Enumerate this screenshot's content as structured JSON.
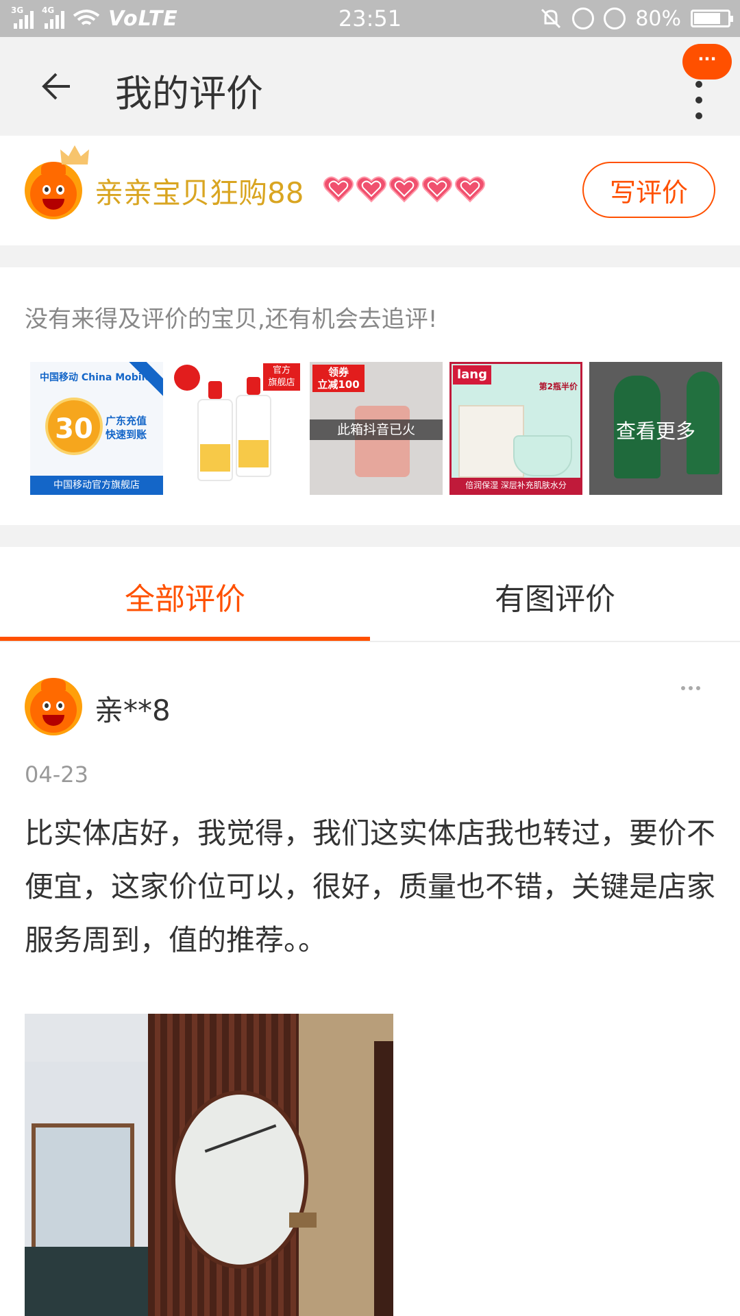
{
  "status_bar": {
    "network_left": "3G",
    "network_right": "4G",
    "volte": "VoLTE",
    "time": "23:51",
    "battery": "80%",
    "battery_level": 0.8
  },
  "header": {
    "title": "我的评价",
    "message_badge": "···"
  },
  "user": {
    "name": "亲亲宝贝狂购88",
    "hearts_count": 5,
    "write_button": "写评价"
  },
  "pending": {
    "tip": "没有来得及评价的宝贝,还有机会去追评!",
    "items": [
      {
        "brand": "中国移动 China Mobile",
        "amount": "30",
        "subtitle_1": "广东充值",
        "subtitle_2": "快速到账",
        "band": "中国移动官方旗舰店"
      },
      {
        "tag_1": "官方",
        "tag_2": "旗舰店"
      },
      {
        "coupon_1": "领券",
        "coupon_2": "立减100",
        "band": "此箱抖音已火"
      },
      {
        "logo": "lang",
        "corner": "第2瓶半价",
        "band": "倍润保湿  深层补充肌肤水分"
      },
      {
        "more": "查看更多"
      }
    ]
  },
  "tabs": {
    "all": "全部评价",
    "with_images": "有图评价",
    "active": "all"
  },
  "review": {
    "user": "亲**8",
    "date": "04-23",
    "text": "比实体店好，我觉得，我们这实体店我也转过，要价不便宜，这家价位可以，很好，质量也不错，关键是店家服务周到，值的推荐。。"
  },
  "colors": {
    "accent": "#ff5000",
    "username": "#d9a521",
    "statusbar": "#bcbcbc"
  }
}
